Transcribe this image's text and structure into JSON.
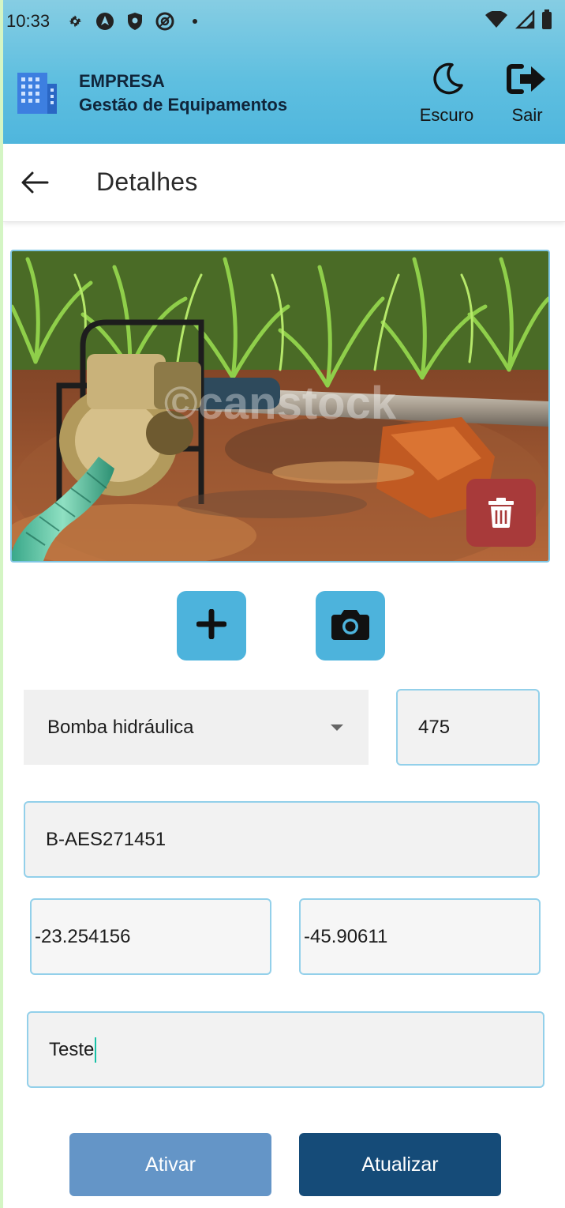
{
  "status_bar": {
    "time": "10:33"
  },
  "header": {
    "company": "EMPRESA",
    "subtitle": "Gestão de Equipamentos",
    "dark_mode_label": "Escuro",
    "exit_label": "Sair"
  },
  "page": {
    "title": "Detalhes"
  },
  "photo": {
    "watermark": "©canstock"
  },
  "form": {
    "equipment_type": "Bomba hidráulica",
    "quantity": "475",
    "serial": "B-AES271451",
    "latitude": "-23.254156",
    "longitude": "-45.90611",
    "description": "Teste"
  },
  "actions": {
    "activate_label": "Ativar",
    "update_label": "Atualizar"
  },
  "colors": {
    "header_blue": "#5fbfe0",
    "action_blue": "#4db3dc",
    "delete_red": "#a83a3a",
    "activate_blue": "#6495c7",
    "update_navy": "#154b78",
    "field_border": "#93d0ea"
  },
  "icons": {
    "status": [
      "settings-icon",
      "navigation-icon",
      "shield-icon",
      "sync-icon",
      "dot-icon",
      "wifi-icon",
      "signal-icon",
      "battery-icon"
    ],
    "header": [
      "building-icon",
      "moon-icon",
      "logout-icon"
    ],
    "page": [
      "arrow-back-icon",
      "trash-icon",
      "plus-icon",
      "camera-icon",
      "dropdown-caret-icon"
    ]
  }
}
